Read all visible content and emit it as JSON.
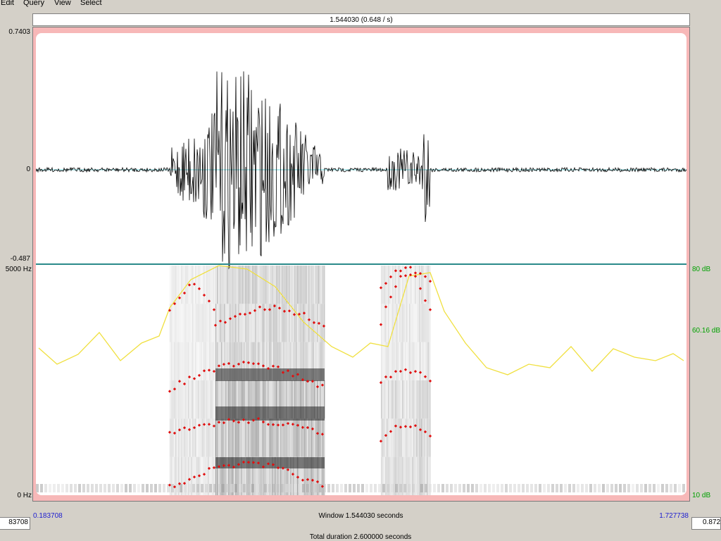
{
  "menu": {
    "items": [
      "Edit",
      "Query",
      "View",
      "Select"
    ]
  },
  "selection_label": "1.544030 (0.648 / s)",
  "waveform": {
    "y_max_label": "0.7403",
    "y_zero_label": "0",
    "y_min_label": "-0.487"
  },
  "spectrogram": {
    "freq_top_label": "5000 Hz",
    "freq_bottom_label": "0 Hz",
    "db_top_label": "80 dB",
    "db_mid_label": "60.16 dB",
    "db_bottom_label": "10 dB"
  },
  "time": {
    "left_outer": "83708",
    "left_visible": "0.183708",
    "window_label": "Window 1.544030 seconds",
    "right_visible": "1.727738",
    "right_outer": "0.872",
    "total_label": "Total duration 2.600000 seconds"
  },
  "colors": {
    "panel_border": "#f7b8b8",
    "waveform": "#000000",
    "baseline": "#6fd8e0",
    "formant": "#e01010",
    "intensity": "#f0e040"
  }
}
